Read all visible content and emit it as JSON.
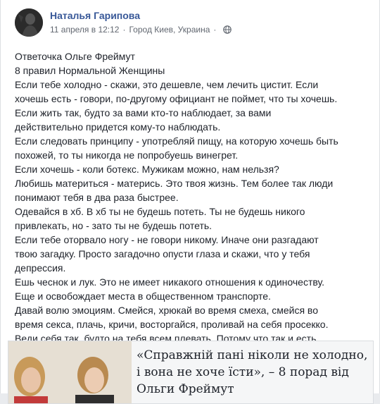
{
  "post": {
    "author": "Наталья Гарипова",
    "date": "11 апреля в 12:12",
    "separator": "·",
    "location": "Город Киев, Украина",
    "privacy_icon": "globe-icon",
    "lines": [
      "Ответочка Ольге Фреймут",
      "8 правил Нормальной Женщины",
      "Если тебе холодно - скажи, это дешевле, чем лечить цистит. Если",
      "хочешь есть - говори, по-другому официант не поймет, что ты хочешь.",
      "Если жить так, будто за вами кто-то наблюдает, за вами",
      "действительно придется кому-то наблюдать.",
      "Если следовать принципу - употребляй пищу, на которую хочешь быть",
      "похожей, то ты никогда не попробуешь винегрет.",
      "Если хочешь - коли ботекс. Мужикам можно, нам нельзя?",
      "Любишь материться - матерись. Это твоя жизнь. Тем более так люди",
      "понимают тебя в два раза быстрее.",
      "Одевайся в хб. В хб ты не будешь потеть. Ты не будешь никого",
      "привлекать, но - зато ты не будешь потеть.",
      "Если тебе оторвало ногу - не говори никому. Иначе они разгадают",
      "твою загадку. Просто загадочно опусти глаза и скажи, что у тебя",
      "депрессия.",
      "Ешь чеснок и лук. Это не имеет никакого отношения к одиночеству.",
      "Еще и освобождает места в общественном транспорте.",
      "Давай волю эмоциям. Смейся, хрюкай во время смеха, смейся во",
      "время секса, плачь, кричи, восторгайся, проливай на себя просекко.",
      "Веди себя так, будто на тебя всем плевать. Потому что так и есть."
    ]
  },
  "link_preview": {
    "title_lines": [
      "«Справжній пані ніколи не холодно,",
      "і вона не хоче їсти», – 8 порад від",
      "Ольги Фреймут"
    ]
  }
}
